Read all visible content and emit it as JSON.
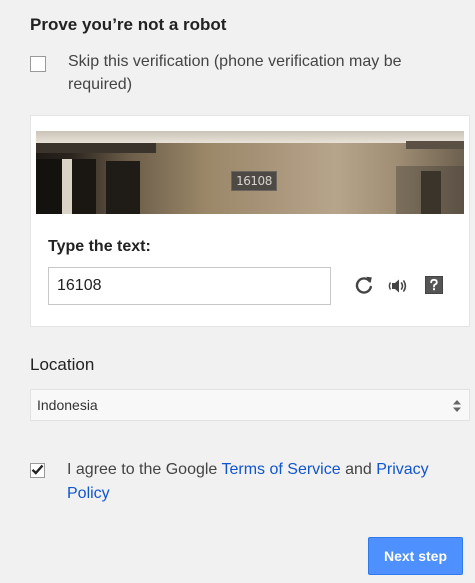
{
  "robot": {
    "title": "Prove you’re not a robot",
    "skip_label": "Skip this verification (phone verification may be required)",
    "skip_checked": false
  },
  "captcha": {
    "image_text": "16108",
    "type_label": "Type the text:",
    "input_value": "16108",
    "icons": [
      "refresh-icon",
      "audio-icon",
      "help-icon"
    ]
  },
  "location": {
    "label": "Location",
    "selected": "Indonesia"
  },
  "agree": {
    "checked": true,
    "prefix": "I agree to the Google ",
    "terms_link": "Terms of Service",
    "middle": " and ",
    "privacy_link": "Privacy Policy"
  },
  "actions": {
    "next_label": "Next step"
  },
  "colors": {
    "background": "#f1f1f1",
    "link": "#1155cc",
    "primary_button": "#4d90fe"
  }
}
